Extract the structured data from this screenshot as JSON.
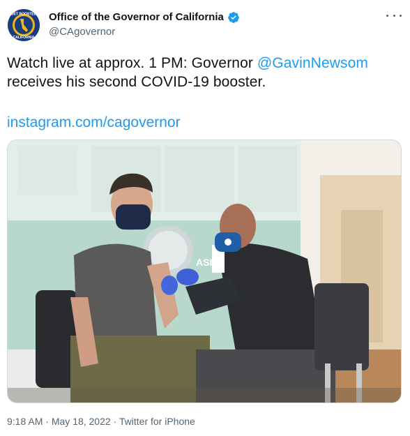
{
  "account": {
    "display_name": "Office of the Governor of California",
    "handle": "@CAgovernor",
    "avatar_text_top": "GET BOOSTED",
    "avatar_text_bottom": "CALIFORNIA",
    "verified_icon": "verified-badge-icon"
  },
  "tweet": {
    "text_part1": "Watch live at approx. 1 PM: Governor ",
    "mention": "@GavinNewsom",
    "text_part2": "receives his second COVID-19 booster.",
    "link": "instagram.com/cagovernor"
  },
  "media": {
    "wall_sign": "ASIAN HEA"
  },
  "meta": {
    "time": "9:18 AM",
    "sep1": " · ",
    "date": "May 18, 2022",
    "sep2": " · ",
    "source": "Twitter for iPhone"
  },
  "colors": {
    "accent": "#1d9bf0",
    "text": "#0f1419",
    "secondary": "#536471"
  }
}
